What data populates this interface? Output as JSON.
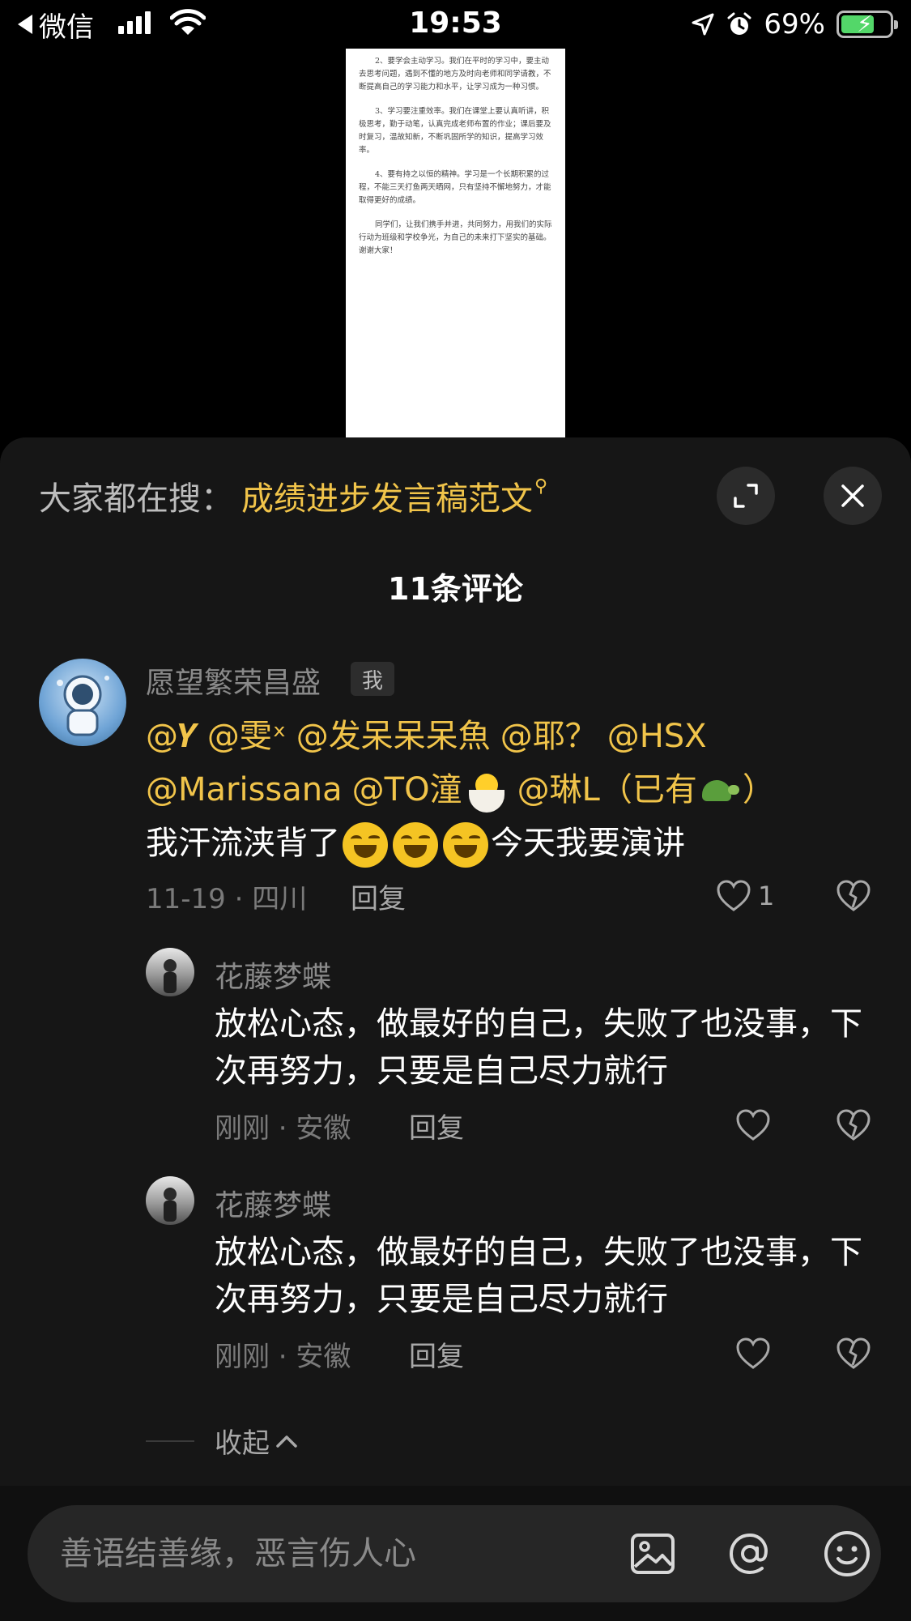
{
  "status_bar": {
    "back_app": "微信",
    "time": "19:53",
    "battery_percent": "69%",
    "battery_level": 0.69,
    "charging": true
  },
  "document_preview": {
    "paragraphs": [
      "2、要学会主动学习。我们在平时的学习中，要主动去思考问题，遇到不懂的地方及时向老师和同学请教，不断提高自己的学习能力和水平，让学习成为一种习惯。",
      "3、学习要注重效率。我们在课堂上要认真听讲，积极思考，勤于动笔，认真完成老师布置的作业；课后要及时复习，温故知新，不断巩固所学的知识，提高学习效率。",
      "4、要有持之以恒的精神。学习是一个长期积累的过程，不能三天打鱼两天晒网，只有坚持不懈地努力，才能取得更好的成绩。",
      "同学们，让我们携手并进，共同努力，用我们的实际行动为班级和学校争光，为自己的未来打下坚实的基础。谢谢大家！"
    ]
  },
  "sheet": {
    "search_label": "大家都在搜：",
    "search_term": "成绩进步发言稿范文",
    "comments_title": "11条评论",
    "expand_icon": "expand-icon",
    "close_icon": "close-icon"
  },
  "main_comment": {
    "user": "愿望繁荣昌盛",
    "me_badge": "我",
    "mentions": [
      "@𝒀",
      "@雯ˣ",
      "@发呆呆呆魚",
      "@耶？",
      "@HSX",
      "@Marissana",
      "@TO潼",
      "@琳L（已有",
      "）"
    ],
    "text_before": "我汗流浃背了",
    "text_after": "今天我要演讲",
    "date_location": "11-19 · 四川",
    "reply_label": "回复",
    "likes": "1"
  },
  "replies": [
    {
      "user": "花藤梦蝶",
      "text": "放松心态，做最好的自己，失败了也没事，下次再努力，只要是自己尽力就行",
      "date_location": "刚刚 · 安徽",
      "reply_label": "回复"
    },
    {
      "user": "花藤梦蝶",
      "text": "放松心态，做最好的自己，失败了也没事，下次再努力，只要是自己尽力就行",
      "date_location": "刚刚 · 安徽",
      "reply_label": "回复"
    }
  ],
  "collapse_label": "收起",
  "input": {
    "placeholder": "善语结善缘，恶言伤人心"
  },
  "colors": {
    "accent_yellow": "#f1c44a",
    "sheet_bg": "#161616",
    "battery_green": "#53d769"
  }
}
